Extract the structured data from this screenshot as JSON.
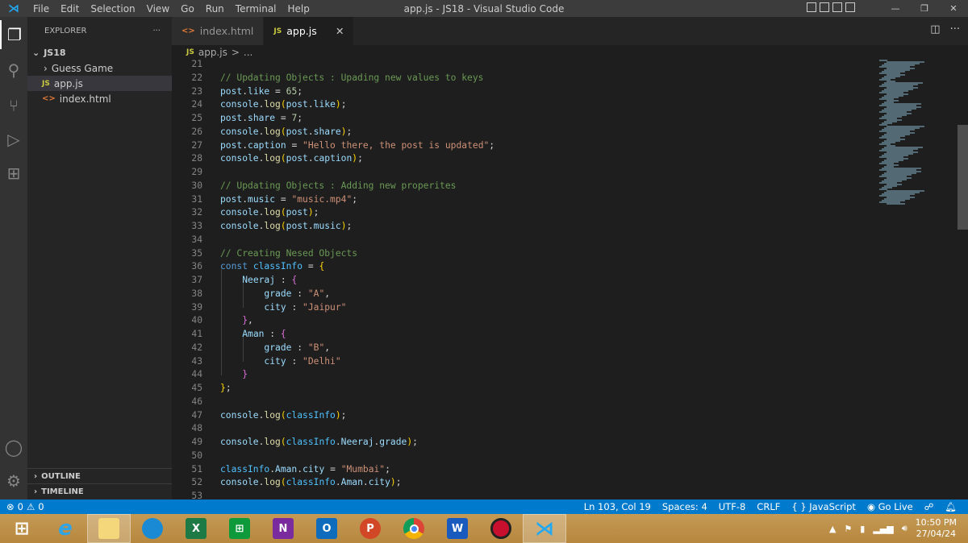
{
  "titlebar": {
    "menu": [
      "File",
      "Edit",
      "Selection",
      "View",
      "Go",
      "Run",
      "Terminal",
      "Help"
    ],
    "title": "app.js - JS18 - Visual Studio Code"
  },
  "sidebar": {
    "header": "EXPLORER",
    "more": "···",
    "folder": "JS18",
    "items": [
      {
        "label": "Guess Game",
        "type": "folder"
      },
      {
        "label": "app.js",
        "type": "js",
        "selected": true
      },
      {
        "label": "index.html",
        "type": "html"
      }
    ],
    "outline": "OUTLINE",
    "timeline": "TIMELINE"
  },
  "tabs": [
    {
      "label": "index.html",
      "icon": "html-icon"
    },
    {
      "label": "app.js",
      "icon": "js-icon",
      "active": true,
      "close": "✕"
    }
  ],
  "breadcrumb": {
    "icon": "JS",
    "file": "app.js",
    "sep": ">",
    "rest": "..."
  },
  "code": {
    "start": 21,
    "lines": [
      [],
      [
        [
          "c",
          "// Updating Objects : Upading new values to keys"
        ]
      ],
      [
        [
          "v",
          "post"
        ],
        [
          "p",
          "."
        ],
        [
          "v",
          "like"
        ],
        [
          "p",
          " = "
        ],
        [
          "n",
          "65"
        ],
        [
          "p",
          ";"
        ]
      ],
      [
        [
          "v",
          "console"
        ],
        [
          "p",
          "."
        ],
        [
          "f",
          "log"
        ],
        [
          "b1",
          "("
        ],
        [
          "v",
          "post"
        ],
        [
          "p",
          "."
        ],
        [
          "v",
          "like"
        ],
        [
          "b1",
          ")"
        ],
        [
          "p",
          ";"
        ]
      ],
      [
        [
          "v",
          "post"
        ],
        [
          "p",
          "."
        ],
        [
          "v",
          "share"
        ],
        [
          "p",
          " = "
        ],
        [
          "n",
          "7"
        ],
        [
          "p",
          ";"
        ]
      ],
      [
        [
          "v",
          "console"
        ],
        [
          "p",
          "."
        ],
        [
          "f",
          "log"
        ],
        [
          "b1",
          "("
        ],
        [
          "v",
          "post"
        ],
        [
          "p",
          "."
        ],
        [
          "v",
          "share"
        ],
        [
          "b1",
          ")"
        ],
        [
          "p",
          ";"
        ]
      ],
      [
        [
          "v",
          "post"
        ],
        [
          "p",
          "."
        ],
        [
          "v",
          "caption"
        ],
        [
          "p",
          " = "
        ],
        [
          "s",
          "\"Hello there, the post is updated\""
        ],
        [
          "p",
          ";"
        ]
      ],
      [
        [
          "v",
          "console"
        ],
        [
          "p",
          "."
        ],
        [
          "f",
          "log"
        ],
        [
          "b1",
          "("
        ],
        [
          "v",
          "post"
        ],
        [
          "p",
          "."
        ],
        [
          "v",
          "caption"
        ],
        [
          "b1",
          ")"
        ],
        [
          "p",
          ";"
        ]
      ],
      [],
      [
        [
          "c",
          "// Updating Objects : Adding new properites"
        ]
      ],
      [
        [
          "v",
          "post"
        ],
        [
          "p",
          "."
        ],
        [
          "v",
          "music"
        ],
        [
          "p",
          " = "
        ],
        [
          "s",
          "\"music.mp4\""
        ],
        [
          "p",
          ";"
        ]
      ],
      [
        [
          "v",
          "console"
        ],
        [
          "p",
          "."
        ],
        [
          "f",
          "log"
        ],
        [
          "b1",
          "("
        ],
        [
          "v",
          "post"
        ],
        [
          "b1",
          ")"
        ],
        [
          "p",
          ";"
        ]
      ],
      [
        [
          "v",
          "console"
        ],
        [
          "p",
          "."
        ],
        [
          "f",
          "log"
        ],
        [
          "b1",
          "("
        ],
        [
          "v",
          "post"
        ],
        [
          "p",
          "."
        ],
        [
          "v",
          "music"
        ],
        [
          "b1",
          ")"
        ],
        [
          "p",
          ";"
        ]
      ],
      [],
      [
        [
          "c",
          "// Creating Nesed Objects"
        ]
      ],
      [
        [
          "k",
          "const "
        ],
        [
          "o",
          "classInfo"
        ],
        [
          "p",
          " = "
        ],
        [
          "b1",
          "{"
        ]
      ],
      [
        [
          "p",
          "    "
        ],
        [
          "v",
          "Neeraj"
        ],
        [
          "p",
          " : "
        ],
        [
          "b2",
          "{"
        ]
      ],
      [
        [
          "p",
          "        "
        ],
        [
          "v",
          "grade"
        ],
        [
          "p",
          " : "
        ],
        [
          "s",
          "\"A\""
        ],
        [
          "p",
          ","
        ]
      ],
      [
        [
          "p",
          "        "
        ],
        [
          "v",
          "city"
        ],
        [
          "p",
          " : "
        ],
        [
          "s",
          "\"Jaipur\""
        ]
      ],
      [
        [
          "p",
          "    "
        ],
        [
          "b2",
          "}"
        ],
        [
          "p",
          ","
        ]
      ],
      [
        [
          "p",
          "    "
        ],
        [
          "v",
          "Aman"
        ],
        [
          "p",
          " : "
        ],
        [
          "b2",
          "{"
        ]
      ],
      [
        [
          "p",
          "        "
        ],
        [
          "v",
          "grade"
        ],
        [
          "p",
          " : "
        ],
        [
          "s",
          "\"B\""
        ],
        [
          "p",
          ","
        ]
      ],
      [
        [
          "p",
          "        "
        ],
        [
          "v",
          "city"
        ],
        [
          "p",
          " : "
        ],
        [
          "s",
          "\"Delhi\""
        ]
      ],
      [
        [
          "p",
          "    "
        ],
        [
          "b2",
          "}"
        ]
      ],
      [
        [
          "b1",
          "}"
        ],
        [
          "p",
          ";"
        ]
      ],
      [],
      [
        [
          "v",
          "console"
        ],
        [
          "p",
          "."
        ],
        [
          "f",
          "log"
        ],
        [
          "b1",
          "("
        ],
        [
          "o",
          "classInfo"
        ],
        [
          "b1",
          ")"
        ],
        [
          "p",
          ";"
        ]
      ],
      [],
      [
        [
          "v",
          "console"
        ],
        [
          "p",
          "."
        ],
        [
          "f",
          "log"
        ],
        [
          "b1",
          "("
        ],
        [
          "o",
          "classInfo"
        ],
        [
          "p",
          "."
        ],
        [
          "v",
          "Neeraj"
        ],
        [
          "p",
          "."
        ],
        [
          "v",
          "grade"
        ],
        [
          "b1",
          ")"
        ],
        [
          "p",
          ";"
        ]
      ],
      [],
      [
        [
          "o",
          "classInfo"
        ],
        [
          "p",
          "."
        ],
        [
          "v",
          "Aman"
        ],
        [
          "p",
          "."
        ],
        [
          "v",
          "city"
        ],
        [
          "p",
          " = "
        ],
        [
          "s",
          "\"Mumbai\""
        ],
        [
          "p",
          ";"
        ]
      ],
      [
        [
          "v",
          "console"
        ],
        [
          "p",
          "."
        ],
        [
          "f",
          "log"
        ],
        [
          "b1",
          "("
        ],
        [
          "o",
          "classInfo"
        ],
        [
          "p",
          "."
        ],
        [
          "v",
          "Aman"
        ],
        [
          "p",
          "."
        ],
        [
          "v",
          "city"
        ],
        [
          "b1",
          ")"
        ],
        [
          "p",
          ";"
        ]
      ],
      []
    ]
  },
  "status": {
    "errors": "0",
    "warnings": "0",
    "position": "Ln 103, Col 19",
    "spaces": "Spaces: 4",
    "encoding": "UTF-8",
    "eol": "CRLF",
    "language": "{ } JavaScript",
    "golive": "Go Live"
  },
  "taskbar": {
    "apps": [
      "start",
      "internet-explorer",
      "file-explorer",
      "edge",
      "excel",
      "store",
      "onenote",
      "outlook",
      "powerpoint",
      "chrome",
      "word",
      "app-red",
      "vscode"
    ],
    "time": "10:50 PM",
    "date": "27/04/24"
  },
  "colors": {
    "accent": "#007acc",
    "editor_bg": "#1e1e1e",
    "sidebar_bg": "#252526"
  }
}
